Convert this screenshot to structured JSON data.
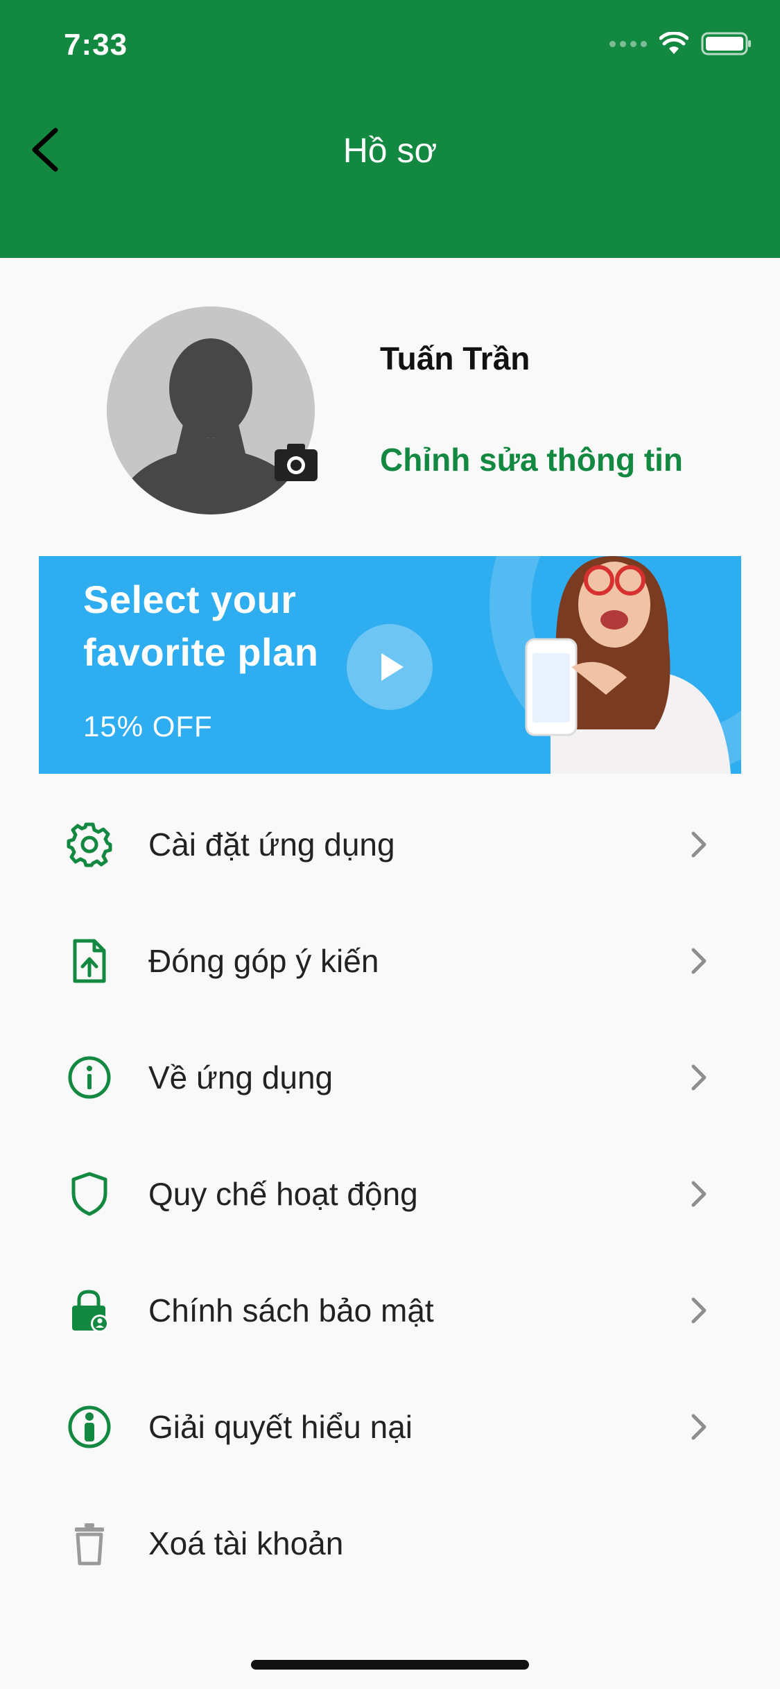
{
  "status_bar": {
    "time": "7:33"
  },
  "header": {
    "title": "Hồ sơ"
  },
  "profile": {
    "name": "Tuấn Trần",
    "edit_label": "Chỉnh sửa thông tin"
  },
  "banner": {
    "line1": "Select your",
    "line2": "favorite plan",
    "promo": "15%  OFF"
  },
  "menu": {
    "items": [
      {
        "label": "Cài đặt ứng dụng",
        "icon": "gear-icon"
      },
      {
        "label": "Đóng góp ý kiến",
        "icon": "file-upload-icon"
      },
      {
        "label": "Về ứng dụng",
        "icon": "info-icon"
      },
      {
        "label": "Quy chế hoạt động",
        "icon": "shield-icon"
      },
      {
        "label": "Chính sách bảo mật",
        "icon": "lock-user-icon"
      },
      {
        "label": "Giải quyết hiểu nại",
        "icon": "person-info-icon"
      },
      {
        "label": "Xoá tài khoản",
        "icon": "trash-icon"
      }
    ]
  },
  "colors": {
    "brand": "#138841",
    "banner": "#2EADF0",
    "background": "#F9F9F9"
  }
}
